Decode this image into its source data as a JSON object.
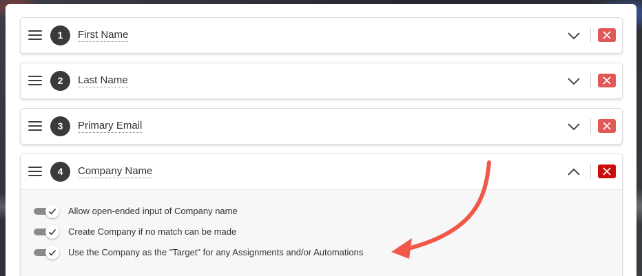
{
  "fields": [
    {
      "number": "1",
      "label": "First Name",
      "expanded": false
    },
    {
      "number": "2",
      "label": "Last Name",
      "expanded": false
    },
    {
      "number": "3",
      "label": "Primary Email",
      "expanded": false
    },
    {
      "number": "4",
      "label": "Company Name",
      "expanded": true
    }
  ],
  "company_options": [
    {
      "label": "Allow open-ended input of Company name",
      "checked": true
    },
    {
      "label": "Create Company if no match can be made",
      "checked": true
    },
    {
      "label": "Use the Company as the \"Target\" for any Assignments and/or Automations",
      "checked": true
    }
  ],
  "colors": {
    "remove_button": "#e05858",
    "remove_button_active": "#cc0c0c",
    "annotation_arrow": "#f0584a"
  },
  "icons": {
    "drag": "drag-handle-icon",
    "collapse": "chevron-down-icon",
    "expand": "chevron-up-icon",
    "remove": "close-icon",
    "check": "check-icon"
  }
}
